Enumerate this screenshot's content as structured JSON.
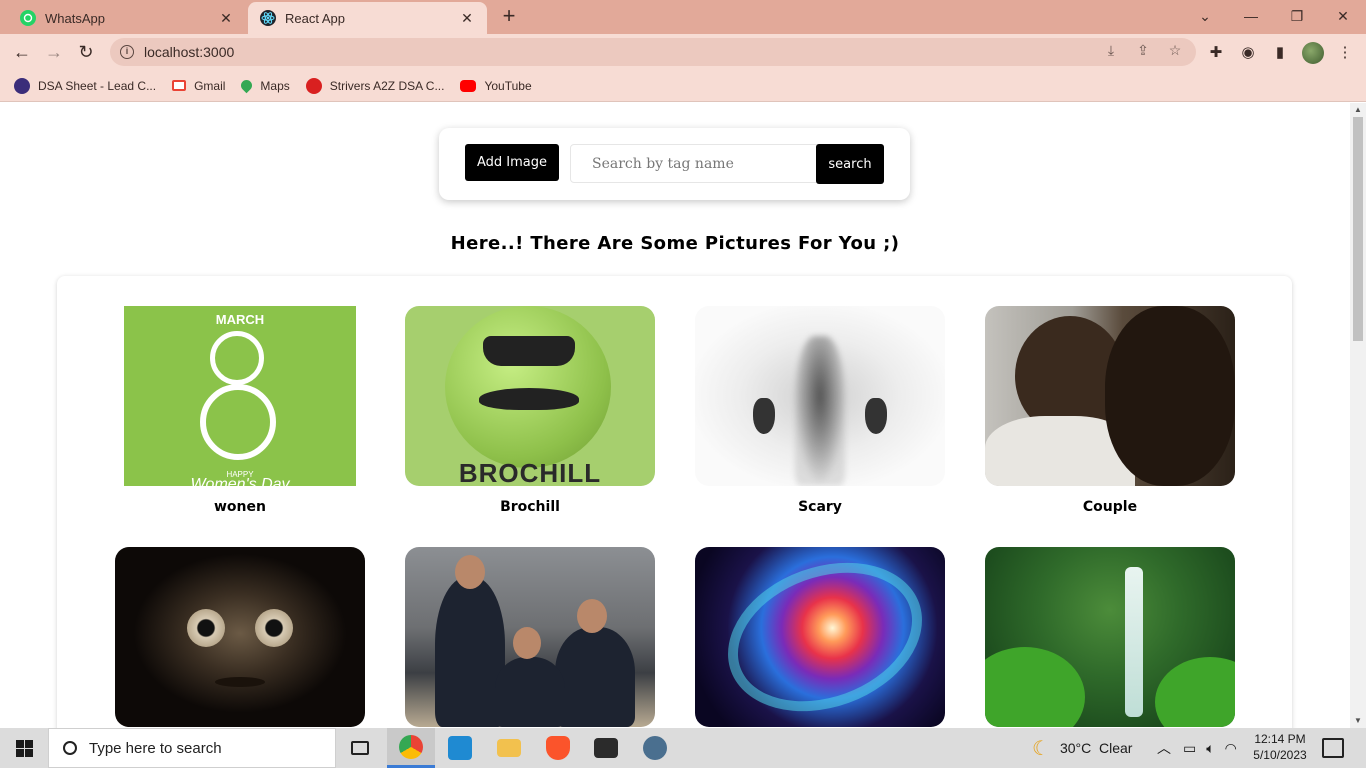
{
  "browser": {
    "tabs": [
      {
        "title": "WhatsApp",
        "icon": "whatsapp-icon"
      },
      {
        "title": "React App",
        "icon": "react-icon"
      }
    ],
    "url": "localhost:3000",
    "bookmarks": [
      {
        "label": "DSA Sheet - Lead C...",
        "icon": "dsa-sheet-icon",
        "color": "#3b2d7a"
      },
      {
        "label": "Gmail",
        "icon": "gmail-icon",
        "color": "#ea4335"
      },
      {
        "label": "Maps",
        "icon": "maps-icon",
        "color": "#34a853"
      },
      {
        "label": "Strivers A2Z DSA C...",
        "icon": "tuf-icon",
        "color": "#d92020"
      },
      {
        "label": "YouTube",
        "icon": "youtube-icon",
        "color": "#ff0000"
      }
    ]
  },
  "app": {
    "add_image_label": "Add Image",
    "search_placeholder": "Search by tag name",
    "search_label": "search",
    "heading": "Here..! There Are Some Pictures For You ;)",
    "images": [
      {
        "caption": "wonen",
        "art": "womens-day-poster"
      },
      {
        "caption": "Brochill",
        "art": "brochill-logo"
      },
      {
        "caption": "Scary",
        "art": "ghost-behind-glass"
      },
      {
        "caption": "Couple",
        "art": "couple-portrait"
      },
      {
        "caption": "",
        "art": "scary-face"
      },
      {
        "caption": "",
        "art": "students-in-classroom"
      },
      {
        "caption": "",
        "art": "spiral-galaxy"
      },
      {
        "caption": "",
        "art": "jungle-waterfall"
      }
    ],
    "womens_day_text": {
      "month": "MARCH",
      "happy": "HAPPY",
      "title": "Women's Day"
    },
    "brochill_text": "BROCHILL"
  },
  "taskbar": {
    "search_text": "Type here to search",
    "weather": "30°C  Clear",
    "time": "12:14 PM",
    "date": "5/10/2023"
  },
  "colors": {
    "tab_bar": "#e2a999",
    "toolbar": "#f7dcd4",
    "button": "#000000"
  }
}
